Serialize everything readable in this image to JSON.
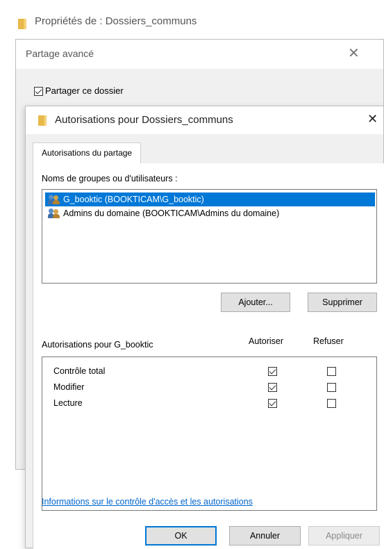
{
  "back_window": {
    "title": "Propriétés de : Dossiers_communs"
  },
  "advanced_sharing": {
    "title": "Partage avancé",
    "share_checkbox_label": "Partager ce dossier",
    "share_checked": true
  },
  "permissions_dialog": {
    "title": "Autorisations pour Dossiers_communs",
    "tab_label": "Autorisations du partage",
    "users_label": "Noms de groupes ou d'utilisateurs :",
    "users": [
      {
        "name": "G_booktic (BOOKTICAM\\G_booktic)",
        "selected": true
      },
      {
        "name": "Admins du domaine (BOOKTICAM\\Admins du domaine)",
        "selected": false
      }
    ],
    "add_button": "Ajouter...",
    "remove_button": "Supprimer",
    "permissions_for_label": "Autorisations pour G_booktic",
    "allow_header": "Autoriser",
    "deny_header": "Refuser",
    "permissions": [
      {
        "name": "Contrôle total",
        "allow": true,
        "deny": false
      },
      {
        "name": "Modifier",
        "allow": true,
        "deny": false
      },
      {
        "name": "Lecture",
        "allow": true,
        "deny": false
      }
    ],
    "info_link": "Informations sur le contrôle d'accès et les autorisations",
    "ok_button": "OK",
    "cancel_button": "Annuler",
    "apply_button": "Appliquer"
  },
  "colors": {
    "selection": "#0078d7",
    "link": "#0066cc",
    "folder": "#e8b84a"
  }
}
